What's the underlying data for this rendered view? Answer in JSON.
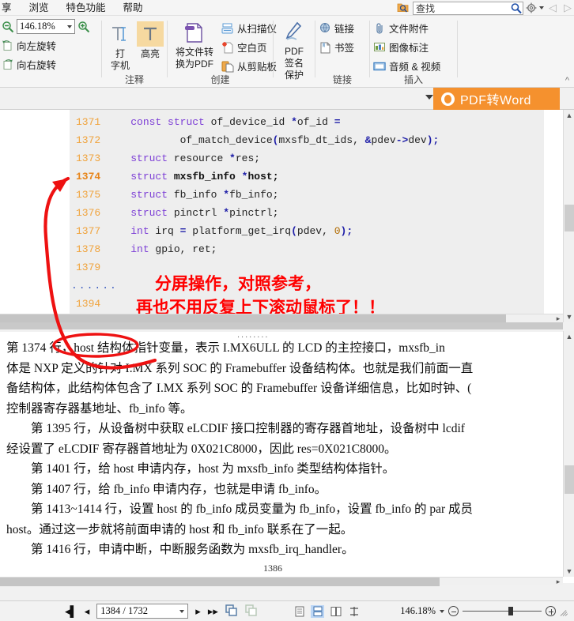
{
  "menubar": {
    "items": [
      "享",
      "浏览",
      "特色功能",
      "帮助"
    ],
    "find_placeholder": "查找",
    "icons": {
      "folder_search": "folder-search-icon",
      "search": "search-icon",
      "gear": "gear-icon"
    }
  },
  "ribbon": {
    "zoom": {
      "value": "146.18%",
      "zoom_out": "zoom-out-icon",
      "zoom_in": "zoom-in-icon"
    },
    "rotate_left": "向左旋转",
    "rotate_right": "向右旋转",
    "annotate": {
      "caption": "注释",
      "typewriter": "打\n字机",
      "typewriter_l1": "打",
      "typewriter_l2": "字机",
      "highlight": "高亮"
    },
    "create": {
      "caption": "创建",
      "to_pdf_l1": "将文件转",
      "to_pdf_l2": "换为PDF",
      "from_scanner": "从扫描仪",
      "blank_page": "空白页",
      "from_clipboard": "从剪贴板"
    },
    "sign": {
      "caption": "",
      "l1": "PDF",
      "l2": "签名",
      "l3": "保护"
    },
    "link": {
      "caption": "链接",
      "link": "链接",
      "bookmark": "书签"
    },
    "insert": {
      "caption": "插入",
      "attachment": "文件附件",
      "image_annot": "图像标注",
      "audio_video": "音频 & 视频"
    }
  },
  "pdf2word": {
    "label": "PDF转Word",
    "accent": "#f5912e"
  },
  "code": {
    "lines": [
      {
        "no": "1371",
        "bold": false,
        "tokens": [
          {
            "t": "    ",
            "c": "id"
          },
          {
            "t": "const",
            "c": "kw"
          },
          {
            "t": " ",
            "c": "id"
          },
          {
            "t": "struct",
            "c": "kw"
          },
          {
            "t": " of_device_id ",
            "c": "id"
          },
          {
            "t": "*",
            "c": "pun"
          },
          {
            "t": "of_id ",
            "c": "id"
          },
          {
            "t": "=",
            "c": "pun"
          }
        ]
      },
      {
        "no": "1372",
        "bold": false,
        "tokens": [
          {
            "t": "            of_match_device",
            "c": "id"
          },
          {
            "t": "(",
            "c": "pun"
          },
          {
            "t": "mxsfb_dt_ids, ",
            "c": "id"
          },
          {
            "t": "&",
            "c": "pun"
          },
          {
            "t": "pdev",
            "c": "id"
          },
          {
            "t": "->",
            "c": "pun"
          },
          {
            "t": "dev",
            "c": "id"
          },
          {
            "t": ");",
            "c": "pun"
          }
        ]
      },
      {
        "no": "1373",
        "bold": false,
        "tokens": [
          {
            "t": "    ",
            "c": "id"
          },
          {
            "t": "struct",
            "c": "kw"
          },
          {
            "t": " resource ",
            "c": "id"
          },
          {
            "t": "*",
            "c": "pun"
          },
          {
            "t": "res;",
            "c": "id"
          }
        ]
      },
      {
        "no": "1374",
        "bold": true,
        "tokens": [
          {
            "t": "    ",
            "c": "id"
          },
          {
            "t": "struct",
            "c": "kw"
          },
          {
            "t": " ",
            "c": "id"
          },
          {
            "t": "mxsfb_info ",
            "c": "bld"
          },
          {
            "t": "*",
            "c": "pun"
          },
          {
            "t": "host;",
            "c": "bld"
          }
        ]
      },
      {
        "no": "1375",
        "bold": false,
        "tokens": [
          {
            "t": "    ",
            "c": "id"
          },
          {
            "t": "struct",
            "c": "kw"
          },
          {
            "t": " fb_info ",
            "c": "id"
          },
          {
            "t": "*",
            "c": "pun"
          },
          {
            "t": "fb_info;",
            "c": "id"
          }
        ]
      },
      {
        "no": "1376",
        "bold": false,
        "tokens": [
          {
            "t": "    ",
            "c": "id"
          },
          {
            "t": "struct",
            "c": "kw"
          },
          {
            "t": " pinctrl ",
            "c": "id"
          },
          {
            "t": "*",
            "c": "pun"
          },
          {
            "t": "pinctrl;",
            "c": "id"
          }
        ]
      },
      {
        "no": "1377",
        "bold": false,
        "tokens": [
          {
            "t": "    ",
            "c": "id"
          },
          {
            "t": "int",
            "c": "kw"
          },
          {
            "t": " irq ",
            "c": "id"
          },
          {
            "t": "=",
            "c": "pun"
          },
          {
            "t": " platform_get_irq",
            "c": "id"
          },
          {
            "t": "(",
            "c": "pun"
          },
          {
            "t": "pdev, ",
            "c": "id"
          },
          {
            "t": "0",
            "c": "num"
          },
          {
            "t": ");",
            "c": "pun"
          }
        ]
      },
      {
        "no": "1378",
        "bold": false,
        "tokens": [
          {
            "t": "    ",
            "c": "id"
          },
          {
            "t": "int",
            "c": "kw"
          },
          {
            "t": " gpio, ret;",
            "c": "id"
          }
        ]
      },
      {
        "no": "1379",
        "bold": false,
        "tokens": []
      },
      {
        "no": "......",
        "bold": false,
        "dots": true,
        "tokens": []
      },
      {
        "no": "1394",
        "bold": false,
        "tokens": []
      }
    ]
  },
  "annotation": {
    "line1": "分屏操作，对照参考，",
    "line2": "再也不用反复上下滚动鼠标了！！",
    "color": "#ff0000"
  },
  "document": {
    "paragraphs": [
      "第 1374 行，host 结构体指针变量，表示 I.MX6ULL 的 LCD 的主控接口，mxsfb_in",
      "体是 NXP 定义的针对 I.MX 系列 SOC 的 Framebuffer 设备结构体。也就是我们前面一直",
      "备结构体，此结构体包含了 I.MX 系列 SOC 的 Framebuffer 设备详细信息，比如时钟、(",
      "控制器寄存器基地址、fb_info 等。",
      "　　第 1395 行，从设备树中获取 eLCDIF 接口控制器的寄存器首地址，设备树中 lcdif",
      "经设置了 eLCDIF 寄存器首地址为 0X021C8000，因此 res=0X021C8000。",
      "　　第 1401 行，给 host 申请内存，host 为 mxsfb_info 类型结构体指针。",
      "　　第 1407 行，给 fb_info 申请内存，也就是申请 fb_info。",
      "　　第 1413~1414 行，设置 host 的 fb_info 成员变量为 fb_info，设置 fb_info 的 par 成员",
      "host。通过这一步就将前面申请的 host 和 fb_info 联系在了一起。",
      "　　第 1416 行，申请中断，中断服务函数为 mxsfb_irq_handler。"
    ],
    "circled_text": "第 1374 行",
    "page_footer": "1386",
    "dots_marker": "........"
  },
  "statusbar": {
    "first_page": "first-page-icon",
    "prev_page": "prev-page-icon",
    "page_value": "1384 / 1732",
    "next_page": "next-page-icon",
    "last_page": "last-page-icon",
    "copy_view": "copy-view-icon",
    "paste_view": "paste-view-icon",
    "view_single": "single-page-view-icon",
    "view_continuous": "continuous-view-icon",
    "view_facing": "facing-page-view-icon",
    "view_split": "split-view-icon",
    "zoom_value": "146.18%"
  }
}
